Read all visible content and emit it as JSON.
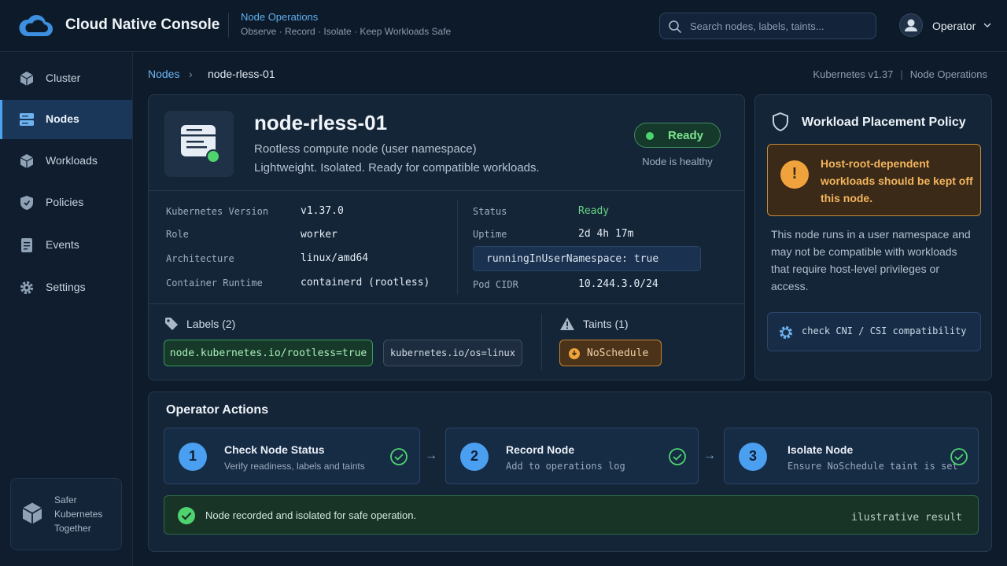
{
  "header": {
    "app_title": "Cloud Native Console",
    "section_title": "Node Operations",
    "section_tagline": "Observe  ·  Record  ·  Isolate  ·  Keep Workloads Safe",
    "search_placeholder": "Search nodes, labels, taints...",
    "user_name": "Operator"
  },
  "sidebar": {
    "items": [
      {
        "label": "Cluster",
        "icon": "cube-icon"
      },
      {
        "label": "Nodes",
        "icon": "server-icon",
        "active": true
      },
      {
        "label": "Workloads",
        "icon": "cubes-icon"
      },
      {
        "label": "Policies",
        "icon": "shield-icon"
      },
      {
        "label": "Events",
        "icon": "document-icon"
      },
      {
        "label": "Settings",
        "icon": "gear-icon"
      }
    ],
    "footer_text": "Safer Kubernetes Together"
  },
  "breadcrumb": {
    "root": "Nodes",
    "current": "node-rless-01",
    "version": "Kubernetes v1.37",
    "context": "Node Operations"
  },
  "node": {
    "name": "node-rless-01",
    "description": "Rootless compute node (user namespace)",
    "subdescription": "Lightweight. Isolated. Ready for compatible workloads.",
    "status_badge": "Ready",
    "status_note": "Node is healthy",
    "details_left": [
      {
        "key": "Kubernetes Version",
        "value": "v1.37.0"
      },
      {
        "key": "Role",
        "value": "worker"
      },
      {
        "key": "Architecture",
        "value": "linux/amd64"
      },
      {
        "key": "Container Runtime",
        "value": "containerd (rootless)"
      }
    ],
    "details_right": {
      "status_key": "Status",
      "status_value": "Ready",
      "uptime_key": "Uptime",
      "uptime_value": "2d 4h 17m",
      "flag": "runningInUserNamespace: true",
      "podcidr_key": "Pod CIDR",
      "podcidr_value": "10.244.3.0/24"
    },
    "labels_title": "Labels (2)",
    "labels": [
      "node.kubernetes.io/rootless=true",
      "kubernetes.io/os=linux"
    ],
    "taints_title": "Taints (1)",
    "taints": [
      "NoSchedule"
    ]
  },
  "policy": {
    "title": "Workload Placement Policy",
    "warning": "Host-root-dependent workloads should be kept off this node.",
    "body": "This node runs in a user namespace and may not be compatible with workloads that require host-level privileges or access.",
    "check": "check CNI / CSI compatibility"
  },
  "operator_actions": {
    "title": "Operator Actions",
    "steps": [
      {
        "num": "1",
        "title": "Check Node Status",
        "desc": "Verify readiness, labels and taints"
      },
      {
        "num": "2",
        "title": "Record Node",
        "desc": "Add to operations log"
      },
      {
        "num": "3",
        "title": "Isolate Node",
        "desc": "Ensure NoSchedule taint is set"
      }
    ],
    "result_text": "Node recorded and isolated for safe operation.",
    "result_note": "ilustrative result"
  },
  "colors": {
    "accent": "#4ea3ef",
    "ready": "#4ed36f",
    "warning": "#f0a23c"
  }
}
